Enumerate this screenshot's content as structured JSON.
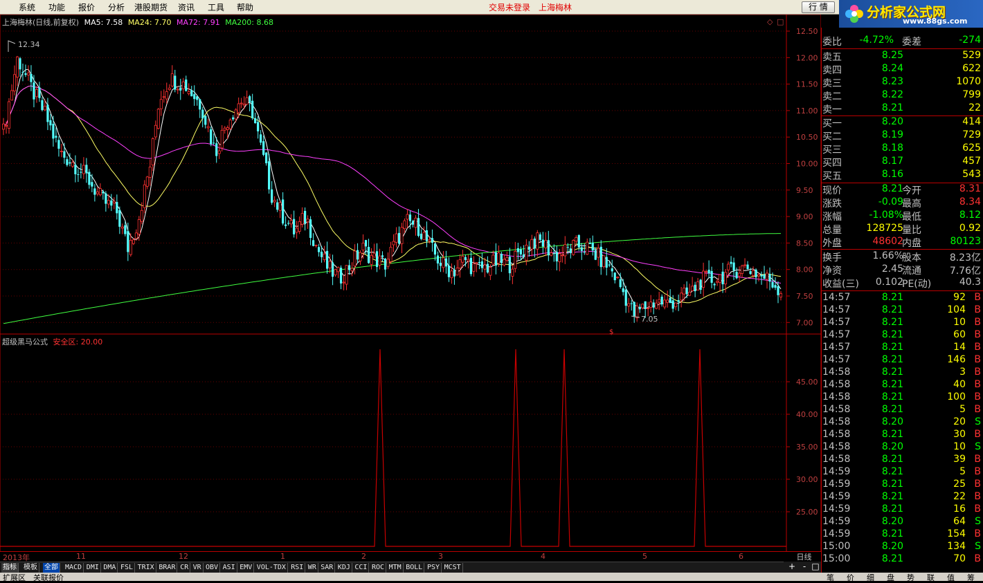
{
  "menu": {
    "items": [
      "系统",
      "功能",
      "报价",
      "分析",
      "港股期货",
      "资讯",
      "工具",
      "帮助"
    ],
    "status": "交易未登录",
    "stock": "上海梅林",
    "quote_btn": "行 情"
  },
  "brand": {
    "name": "分析家公式网",
    "url": "www.88gs.com"
  },
  "kline": {
    "title": "上海梅林(日线,前复权)",
    "ma5": "MA5: 7.58",
    "ma24": "MA24: 7.70",
    "ma72": "MA72: 7.91",
    "ma200": "MA200: 8.68",
    "high_label": "12.34",
    "low_label": "7.05",
    "price_axis": [
      "12.50",
      "12.00",
      "11.50",
      "11.00",
      "10.50",
      "10.00",
      "9.50",
      "9.00",
      "8.50",
      "8.00",
      "7.50",
      "7.00"
    ],
    "marker": "$",
    "colors": {
      "up": "#ff3232",
      "down": "#54ffff",
      "ma5": "#ffffff",
      "ma24": "#ffff66",
      "ma72": "#ff40ff",
      "ma200": "#40ff40"
    }
  },
  "indicator": {
    "name": "超级黑马公式",
    "label": "安全区: 20.00",
    "axis": [
      "45.00",
      "40.00",
      "35.00",
      "30.00",
      "25.00"
    ],
    "color": "#c80000"
  },
  "xaxis": {
    "labels": [
      "2013年",
      "11",
      "12",
      "1",
      "2",
      "3",
      "4",
      "5",
      "6"
    ],
    "period": "日线"
  },
  "tabs": [
    "指标",
    "模板",
    "全部",
    "MACD",
    "DMI",
    "DMA",
    "FSL",
    "TRIX",
    "BRAR",
    "CR",
    "VR",
    "OBV",
    "ASI",
    "EMV",
    "VOL-TDX",
    "RSI",
    "WR",
    "SAR",
    "KDJ",
    "CCI",
    "ROC",
    "MTM",
    "BOLL",
    "PSY",
    "MCST"
  ],
  "zoom": {
    "plus": "+",
    "minus": "-"
  },
  "bottom": {
    "left": "扩展区",
    "right": "关联报价"
  },
  "side": {
    "partial": {
      "label": "委比",
      "value": "-4.72%",
      "label2": "委差",
      "value2": "-274"
    },
    "sell": [
      {
        "label": "卖五",
        "price": "8.25",
        "vol": "529"
      },
      {
        "label": "卖四",
        "price": "8.24",
        "vol": "622"
      },
      {
        "label": "卖三",
        "price": "8.23",
        "vol": "1070"
      },
      {
        "label": "卖二",
        "price": "8.22",
        "vol": "799"
      },
      {
        "label": "卖一",
        "price": "8.21",
        "vol": "22"
      }
    ],
    "buy": [
      {
        "label": "买一",
        "price": "8.20",
        "vol": "414"
      },
      {
        "label": "买二",
        "price": "8.19",
        "vol": "729"
      },
      {
        "label": "买三",
        "price": "8.18",
        "vol": "625"
      },
      {
        "label": "买四",
        "price": "8.17",
        "vol": "457"
      },
      {
        "label": "买五",
        "price": "8.16",
        "vol": "543"
      }
    ],
    "stats": [
      {
        "l1": "现价",
        "v1": "8.21",
        "l2": "今开",
        "v2": "8.31",
        "c1": "#00ff00",
        "c2": "#ff3232"
      },
      {
        "l1": "涨跌",
        "v1": "-0.09",
        "l2": "最高",
        "v2": "8.34",
        "c1": "#00ff00",
        "c2": "#ff3232"
      },
      {
        "l1": "涨幅",
        "v1": "-1.08%",
        "l2": "最低",
        "v2": "8.12",
        "c1": "#00ff00",
        "c2": "#00ff00"
      },
      {
        "l1": "总量",
        "v1": "128725",
        "l2": "量比",
        "v2": "0.92",
        "c1": "#ffff00",
        "c2": "#ffff00"
      },
      {
        "l1": "外盘",
        "v1": "48602",
        "l2": "内盘",
        "v2": "80123",
        "c1": "#ff3232",
        "c2": "#00ff00"
      }
    ],
    "finance": [
      {
        "l1": "换手",
        "v1": "1.66%",
        "l2": "股本",
        "v2": "8.23亿"
      },
      {
        "l1": "净资",
        "v1": "2.45",
        "l2": "流通",
        "v2": "7.76亿"
      },
      {
        "l1": "收益(三)",
        "v1": "0.102",
        "l2": "PE(动)",
        "v2": "40.3"
      }
    ],
    "ticks": [
      {
        "t": "14:57",
        "p": "8.21",
        "v": "92",
        "s": "B"
      },
      {
        "t": "14:57",
        "p": "8.21",
        "v": "104",
        "s": "B"
      },
      {
        "t": "14:57",
        "p": "8.21",
        "v": "10",
        "s": "B"
      },
      {
        "t": "14:57",
        "p": "8.21",
        "v": "60",
        "s": "B"
      },
      {
        "t": "14:57",
        "p": "8.21",
        "v": "14",
        "s": "B"
      },
      {
        "t": "14:57",
        "p": "8.21",
        "v": "146",
        "s": "B"
      },
      {
        "t": "14:58",
        "p": "8.21",
        "v": "3",
        "s": "B"
      },
      {
        "t": "14:58",
        "p": "8.21",
        "v": "40",
        "s": "B"
      },
      {
        "t": "14:58",
        "p": "8.21",
        "v": "100",
        "s": "B"
      },
      {
        "t": "14:58",
        "p": "8.21",
        "v": "5",
        "s": "B"
      },
      {
        "t": "14:58",
        "p": "8.20",
        "v": "20",
        "s": "S"
      },
      {
        "t": "14:58",
        "p": "8.21",
        "v": "30",
        "s": "B"
      },
      {
        "t": "14:58",
        "p": "8.20",
        "v": "10",
        "s": "S"
      },
      {
        "t": "14:58",
        "p": "8.21",
        "v": "39",
        "s": "B"
      },
      {
        "t": "14:59",
        "p": "8.21",
        "v": "5",
        "s": "B"
      },
      {
        "t": "14:59",
        "p": "8.21",
        "v": "25",
        "s": "B"
      },
      {
        "t": "14:59",
        "p": "8.21",
        "v": "22",
        "s": "B"
      },
      {
        "t": "14:59",
        "p": "8.21",
        "v": "16",
        "s": "B"
      },
      {
        "t": "14:59",
        "p": "8.20",
        "v": "64",
        "s": "S"
      },
      {
        "t": "14:59",
        "p": "8.21",
        "v": "154",
        "s": "B"
      },
      {
        "t": "15:00",
        "p": "8.20",
        "v": "134",
        "s": "S"
      },
      {
        "t": "15:00",
        "p": "8.21",
        "v": "70",
        "s": "B"
      }
    ],
    "tabs": [
      "笔",
      "价",
      "细",
      "盘",
      "势",
      "联",
      "值",
      "筹"
    ]
  }
}
